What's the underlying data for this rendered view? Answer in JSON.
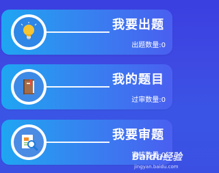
{
  "menu": {
    "items": [
      {
        "title": "我要出题",
        "subtitle": "出题数量:0",
        "icon": "lightbulb-icon"
      },
      {
        "title": "我的题目",
        "subtitle": "过审数量:0",
        "icon": "notebook-icon"
      },
      {
        "title": "我要审题",
        "subtitle": "审核数量:0",
        "icon": "document-search-icon"
      }
    ]
  },
  "watermark": {
    "brand": "Baidu经验",
    "url": "jingyan.baidu.com"
  },
  "colors": {
    "background": "#3a45e2",
    "card_start": "#1fa6f2",
    "card_end": "#4a5ff0",
    "text": "#ffffff",
    "bulb": "#f7c531",
    "notebook": "#8a5a3c",
    "magnifier": "#1e7ad8"
  }
}
